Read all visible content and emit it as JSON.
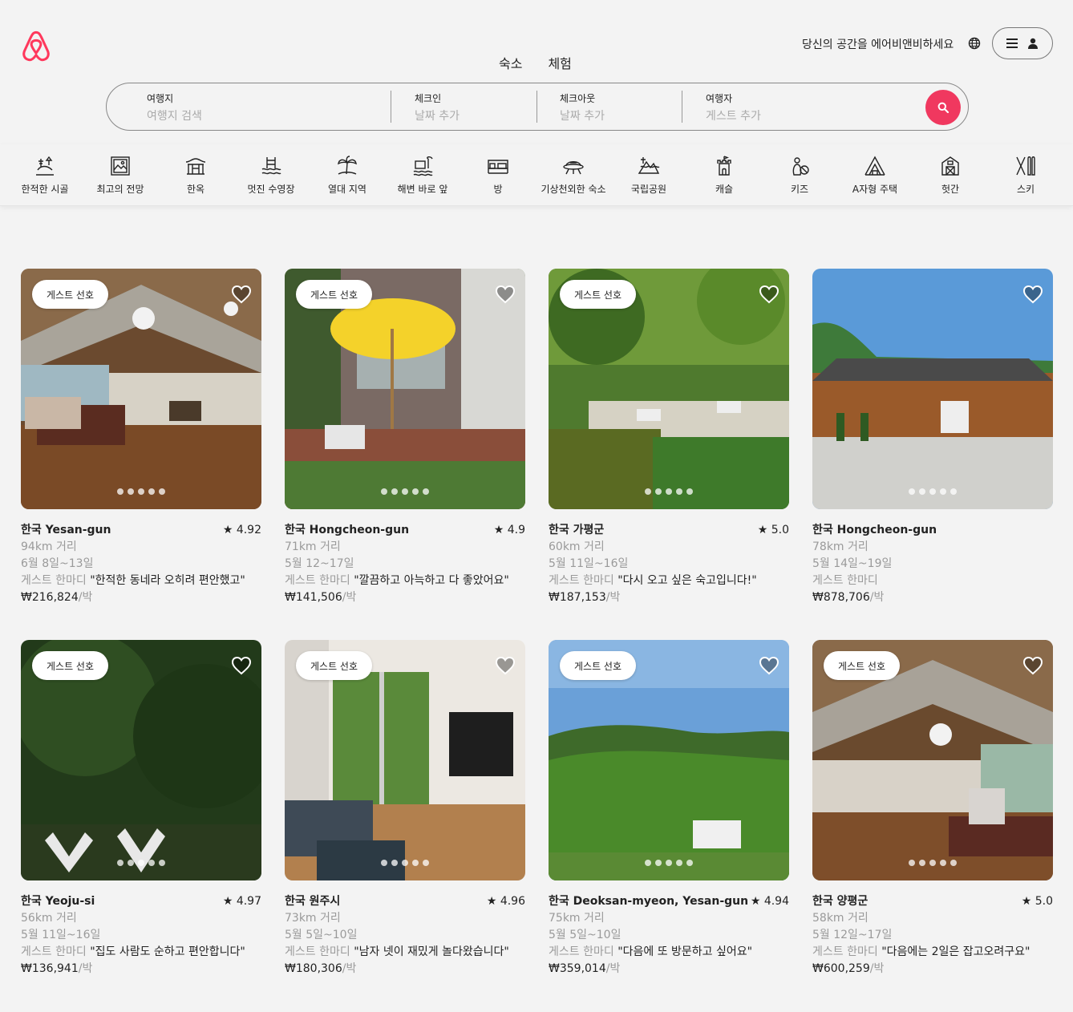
{
  "header": {
    "tabs": [
      "숙소",
      "체험"
    ],
    "host_link": "당신의 공간을 에어비앤비하세요",
    "brand_color": "#FF385C"
  },
  "search": {
    "segments": [
      {
        "label": "여행지",
        "placeholder": "여행지 검색"
      },
      {
        "label": "체크인",
        "placeholder": "날짜 추가"
      },
      {
        "label": "체크아웃",
        "placeholder": "날짜 추가"
      },
      {
        "label": "여행자",
        "placeholder": "게스트 추가"
      }
    ]
  },
  "categories": [
    {
      "label": "한적한 시골",
      "icon": "countryside-icon"
    },
    {
      "label": "최고의 전망",
      "icon": "amazing-view-icon"
    },
    {
      "label": "한옥",
      "icon": "hanok-icon"
    },
    {
      "label": "멋진 수영장",
      "icon": "pool-icon"
    },
    {
      "label": "열대 지역",
      "icon": "tropical-icon"
    },
    {
      "label": "해변 바로 앞",
      "icon": "beachfront-icon"
    },
    {
      "label": "방",
      "icon": "room-icon"
    },
    {
      "label": "기상천외한 숙소",
      "icon": "omg-icon"
    },
    {
      "label": "국립공원",
      "icon": "national-park-icon"
    },
    {
      "label": "캐슬",
      "icon": "castle-icon"
    },
    {
      "label": "키즈",
      "icon": "kids-icon"
    },
    {
      "label": "A자형 주택",
      "icon": "a-frame-icon"
    },
    {
      "label": "헛간",
      "icon": "barn-icon"
    },
    {
      "label": "스키",
      "icon": "ski-icon"
    }
  ],
  "listings": [
    {
      "badge": "게스트 선호",
      "title": "한국 Yesan-gun",
      "rating": "★ 4.92",
      "distance": "94km 거리",
      "dates": "6월 8일~13일",
      "review_label": "게스트 한마디",
      "review": "\"한적한 동네라 오히려 편안했고\"",
      "price": "₩216,824",
      "per": "/박",
      "photo": "interior-wood-lodge"
    },
    {
      "badge": "게스트 선호",
      "title": "한국 Hongcheon-gun",
      "rating": "★ 4.9",
      "distance": "71km 거리",
      "dates": "5월 12~17일",
      "review_label": "게스트 한마디",
      "review": "\"깔끔하고 아늑하고 다 좋았어요\"",
      "price": "₩141,506",
      "per": "/박",
      "photo": "yellow-umbrella-patio"
    },
    {
      "badge": "게스트 선호",
      "title": "한국 가평군",
      "rating": "★ 5.0",
      "distance": "60km 거리",
      "dates": "5월 11일~16일",
      "review_label": "게스트 한마디",
      "review": "\"다시 오고 싶은 숙고입니다!\"",
      "price": "₩187,153",
      "per": "/박",
      "photo": "garden-pond-deck"
    },
    {
      "badge": "",
      "title": "한국 Hongcheon-gun",
      "rating": "",
      "distance": "78km 거리",
      "dates": "5월 14일~19일",
      "review_label": "게스트 한마디",
      "review": "",
      "price": "₩878,706",
      "per": "/박",
      "photo": "hanok-house-exterior"
    },
    {
      "badge": "게스트 선호",
      "title": "한국 Yeoju-si",
      "rating": "★ 4.97",
      "distance": "56km 거리",
      "dates": "5월 11일~16일",
      "review_label": "게스트 한마디",
      "review": "\"집도 사람도 순하고 편안합니다\"",
      "price": "₩136,941",
      "per": "/박",
      "photo": "forest-chairs"
    },
    {
      "badge": "게스트 선호",
      "title": "한국 원주시",
      "rating": "★ 4.96",
      "distance": "73km 거리",
      "dates": "5월 5일~10일",
      "review_label": "게스트 한마디",
      "review": "\"남자 넷이 재밌게 놀다왔습니다\"",
      "price": "₩180,306",
      "per": "/박",
      "photo": "living-room-tv"
    },
    {
      "badge": "게스트 선호",
      "title": "한국 Deoksan-myeon, Yesan-gun",
      "rating": "★ 4.94",
      "distance": "75km 거리",
      "dates": "5월 5일~10일",
      "review_label": "게스트 한마디",
      "review": "\"다음에 또 방문하고 싶어요\"",
      "price": "₩359,014",
      "per": "/박",
      "photo": "green-hills-view"
    },
    {
      "badge": "게스트 선호",
      "title": "한국 양평군",
      "rating": "★ 5.0",
      "distance": "58km 거리",
      "dates": "5월 12일~17일",
      "review_label": "게스트 한마디",
      "review": "\"다음에는 2일은 잡고오려구요\"",
      "price": "₩600,259",
      "per": "/박",
      "photo": "interior-wood-lodge-2"
    }
  ]
}
